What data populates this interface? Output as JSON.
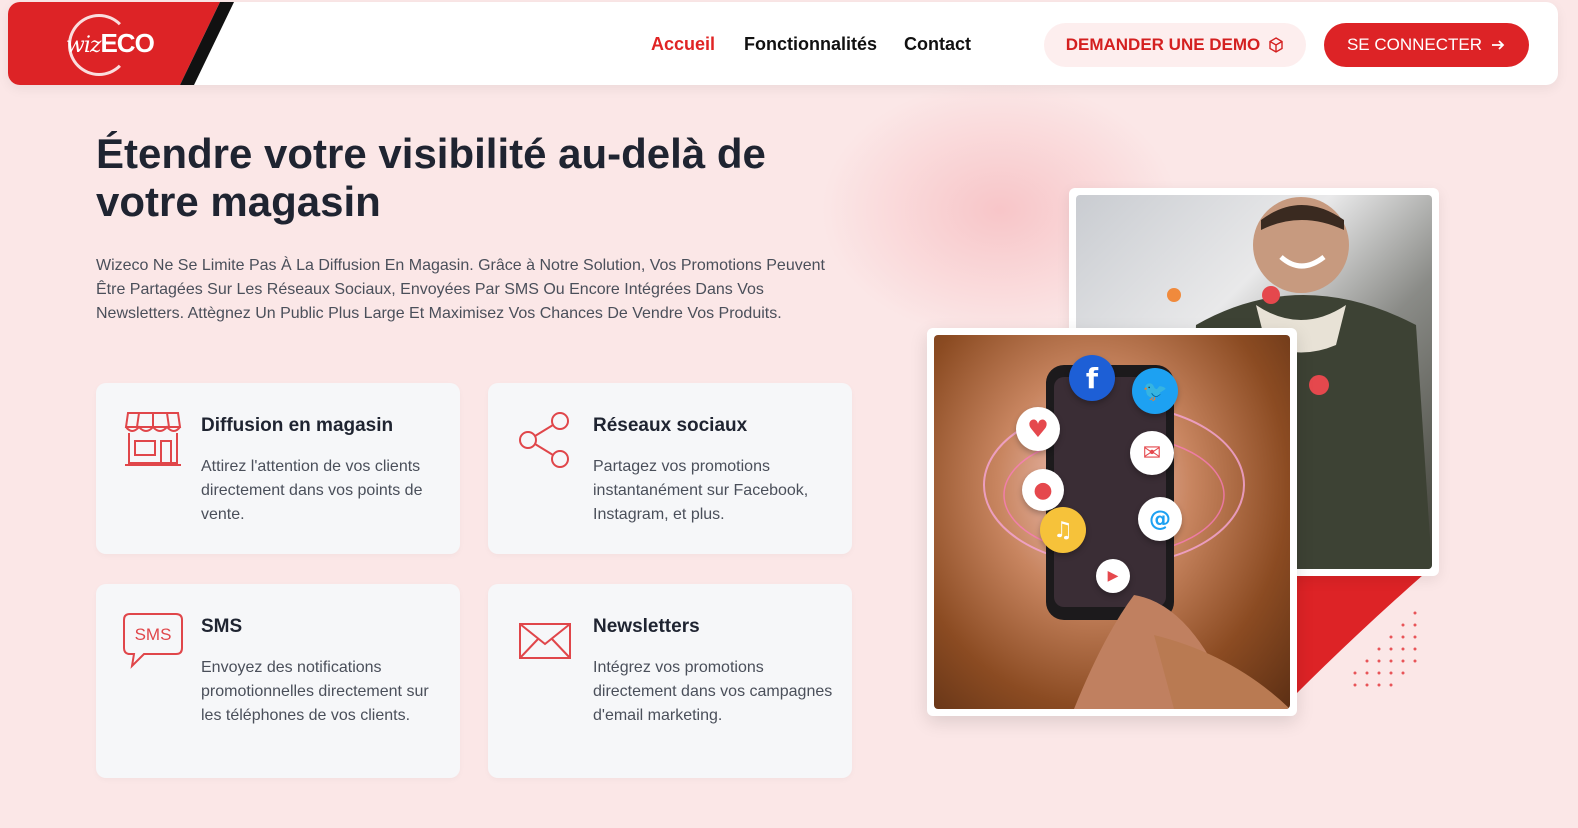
{
  "brand": {
    "logo_wiz": "wiz",
    "logo_eco": "ECO",
    "accent": "#dd2326"
  },
  "nav": {
    "items": [
      "Accueil",
      "Fonctionnalités",
      "Contact"
    ],
    "active": "Accueil"
  },
  "buttons": {
    "demo_label": "DEMANDER UNE DEMO",
    "login_label": "SE CONNECTER"
  },
  "hero": {
    "title": "Étendre votre visibilité au-delà de votre magasin",
    "description": "Wizeco Ne Se Limite Pas À La Diffusion En Magasin. Grâce à Notre Solution, Vos Promotions Peuvent Être Partagées Sur Les Réseaux Sociaux, Envoyées Par SMS Ou Encore Intégrées Dans Vos Newsletters. Attègnez Un Public Plus Large Et Maximisez Vos Chances De Vendre Vos Produits."
  },
  "features": [
    {
      "icon": "store-icon",
      "title": "Diffusion en magasin",
      "text": "Attirez l'attention de vos clients directement dans vos points de vente."
    },
    {
      "icon": "share-icon",
      "title": "Réseaux sociaux",
      "text": "Partagez vos promotions instantanément sur Facebook, Instagram, et plus."
    },
    {
      "icon": "sms-icon",
      "sms_label": "SMS",
      "title": "SMS",
      "text": "Envoyez des notifications promotionnelles directement sur les téléphones de vos clients."
    },
    {
      "icon": "envelope-icon",
      "title": "Newsletters",
      "text": "Intégrez vos promotions directement dans vos campagnes d'email marketing."
    }
  ]
}
